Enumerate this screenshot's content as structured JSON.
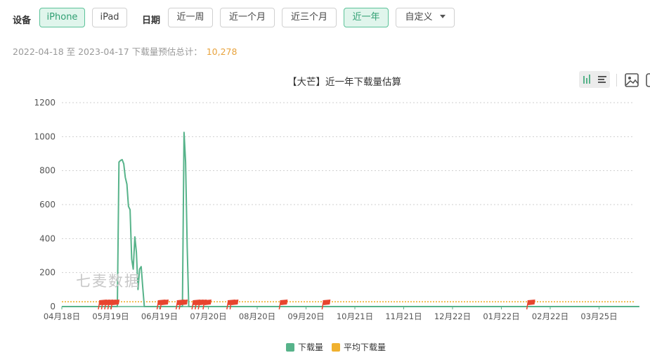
{
  "filters": {
    "device_label": "设备",
    "devices": [
      {
        "label": "iPhone",
        "active": true
      },
      {
        "label": "iPad",
        "active": false
      }
    ],
    "date_label": "日期",
    "ranges": [
      {
        "label": "近一周",
        "active": false
      },
      {
        "label": "近一个月",
        "active": false
      },
      {
        "label": "近三个月",
        "active": false
      },
      {
        "label": "近一年",
        "active": true
      },
      {
        "label": "自定义",
        "active": false
      }
    ]
  },
  "summary": {
    "text": "2022-04-18 至 2023-04-17 下载量预估总计：",
    "total": "10,278"
  },
  "watermark": "七麦数据",
  "colors": {
    "accent": "#5cc299",
    "download": "#57b38a",
    "average": "#f0b12f",
    "flag": "#e8442e"
  },
  "chart_data": {
    "type": "line",
    "title": "【大芒】近一年下载量估算",
    "ylim": [
      0,
      1200
    ],
    "y_ticks": [
      "0",
      "200",
      "400",
      "600",
      "800",
      "1000",
      "1200"
    ],
    "x_ticks": [
      "04月18日",
      "05月19日",
      "06月19日",
      "07月20日",
      "08月20日",
      "09月20日",
      "10月21日",
      "11月21日",
      "12月22日",
      "01月22日",
      "02月22日",
      "03月25日"
    ],
    "grid": true,
    "legend_position": "bottom",
    "series": [
      {
        "name": "下载量",
        "color": "#57b38a",
        "points": [
          [
            0,
            0
          ],
          [
            35,
            0
          ],
          [
            36,
            850
          ],
          [
            37,
            860
          ],
          [
            38,
            865
          ],
          [
            39,
            840
          ],
          [
            40,
            760
          ],
          [
            41,
            720
          ],
          [
            42,
            590
          ],
          [
            43,
            570
          ],
          [
            44,
            280
          ],
          [
            45,
            220
          ],
          [
            46,
            410
          ],
          [
            47,
            320
          ],
          [
            48,
            100
          ],
          [
            49,
            220
          ],
          [
            50,
            235
          ],
          [
            51,
            110
          ],
          [
            52,
            0
          ],
          [
            76,
            0
          ],
          [
            77,
            1025
          ],
          [
            78,
            850
          ],
          [
            79,
            350
          ],
          [
            80,
            0
          ],
          [
            364,
            0
          ]
        ]
      },
      {
        "name": "平均下载量",
        "color": "#f0b12f",
        "value": 28
      }
    ],
    "flag_days": [
      23,
      25,
      27,
      29,
      31,
      60,
      62,
      72,
      74,
      82,
      84,
      86,
      89,
      104,
      106,
      137,
      164,
      293
    ]
  }
}
